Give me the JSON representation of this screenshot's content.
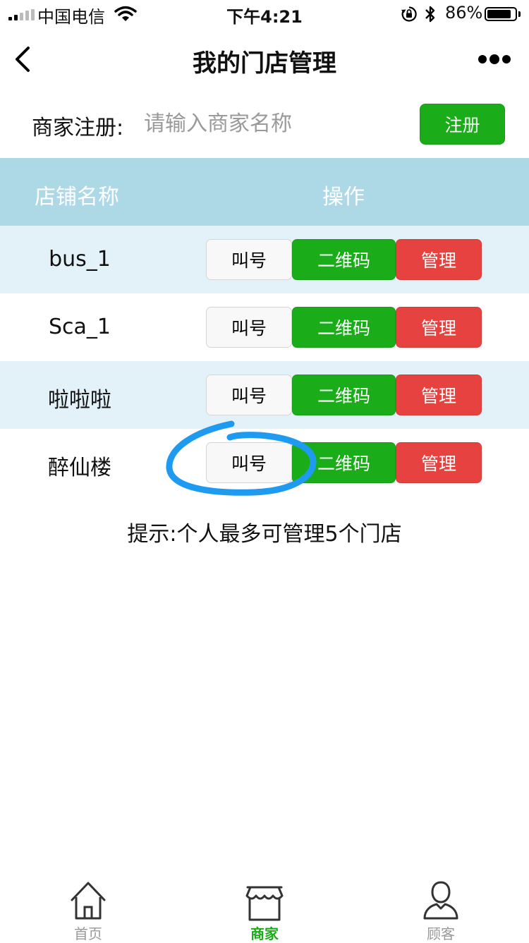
{
  "status_bar": {
    "carrier": "中国电信",
    "time": "下午4:21",
    "battery_percent": "86%",
    "battery_level": 0.86,
    "icons": [
      "signal-icon",
      "wifi-icon",
      "rotation-lock-icon",
      "bluetooth-icon",
      "battery-icon"
    ]
  },
  "nav": {
    "title": "我的门店管理",
    "back_icon": "chevron-left-icon",
    "more_icon": "more-dots-icon"
  },
  "register": {
    "label": "商家注册:",
    "placeholder": "请输入商家名称",
    "value": "",
    "button": "注册"
  },
  "table": {
    "headers": [
      "店铺名称",
      "操作"
    ],
    "row_colors": [
      "#e3f2f9",
      "#ffffff",
      "#e3f2f9",
      "#ffffff"
    ],
    "rows": [
      {
        "name": "bus_1",
        "actions": [
          "叫号",
          "二维码",
          "管理"
        ]
      },
      {
        "name": "Sca_1",
        "actions": [
          "叫号",
          "二维码",
          "管理"
        ]
      },
      {
        "name": "啦啦啦",
        "actions": [
          "叫号",
          "二维码",
          "管理"
        ]
      },
      {
        "name": "醉仙楼",
        "actions": [
          "叫号",
          "二维码",
          "管理"
        ]
      }
    ]
  },
  "tip": "提示:个人最多可管理5个门店",
  "tab_bar": {
    "items": [
      {
        "label": "首页",
        "icon": "home-icon",
        "active": false
      },
      {
        "label": "商家",
        "icon": "store-icon",
        "active": true
      },
      {
        "label": "顾客",
        "icon": "person-icon",
        "active": false
      }
    ]
  },
  "colors": {
    "primary_green": "#1aad19",
    "danger_red": "#e64340",
    "table_header": "#add8e6",
    "row_stripe": "#e3f2f9",
    "annotation_blue": "#1e9bf0"
  }
}
